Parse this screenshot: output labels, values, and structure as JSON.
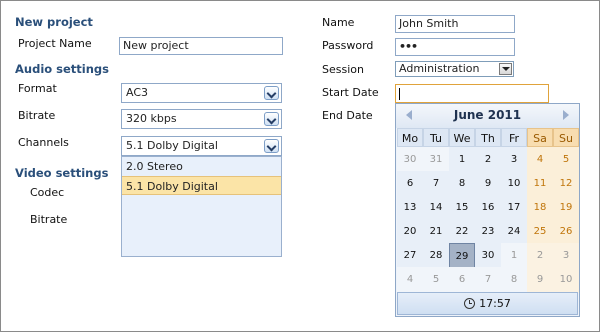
{
  "left": {
    "new_project_heading": "New project",
    "project_name_label": "Project Name",
    "project_name_value": "New project",
    "audio_heading": "Audio settings",
    "format_label": "Format",
    "format_value": "AC3",
    "bitrate_label": "Bitrate",
    "bitrate_value": "320 kbps",
    "channels_label": "Channels",
    "channels_value": "5.1 Dolby Digital",
    "channels_options": [
      "2.0 Stereo",
      "5.1 Dolby Digital"
    ],
    "video_heading": "Video settings",
    "codec_label": "Codec",
    "video_bitrate_label": "Bitrate"
  },
  "right": {
    "name_label": "Name",
    "name_value": "John Smith",
    "password_label": "Password",
    "password_value": "•••",
    "session_label": "Session",
    "session_value": "Administration",
    "start_date_label": "Start Date",
    "end_date_label": "End Date"
  },
  "calendar": {
    "title": "June 2011",
    "weekdays": [
      "Mo",
      "Tu",
      "We",
      "Th",
      "Fr",
      "Sa",
      "Su"
    ],
    "weeks": [
      [
        "30",
        "31",
        "1",
        "2",
        "3",
        "4",
        "5"
      ],
      [
        "6",
        "7",
        "8",
        "9",
        "10",
        "11",
        "12"
      ],
      [
        "13",
        "14",
        "15",
        "16",
        "17",
        "18",
        "19"
      ],
      [
        "20",
        "21",
        "22",
        "23",
        "24",
        "25",
        "26"
      ],
      [
        "27",
        "28",
        "29",
        "30",
        "1",
        "2",
        "3"
      ],
      [
        "4",
        "5",
        "6",
        "7",
        "8",
        "9",
        "10"
      ]
    ],
    "selected_day": "29",
    "time": "17:57"
  },
  "colors": {
    "section_heading": "#2a4f7a",
    "weekend": "#c0750a",
    "focus_border": "#e0a33b"
  }
}
